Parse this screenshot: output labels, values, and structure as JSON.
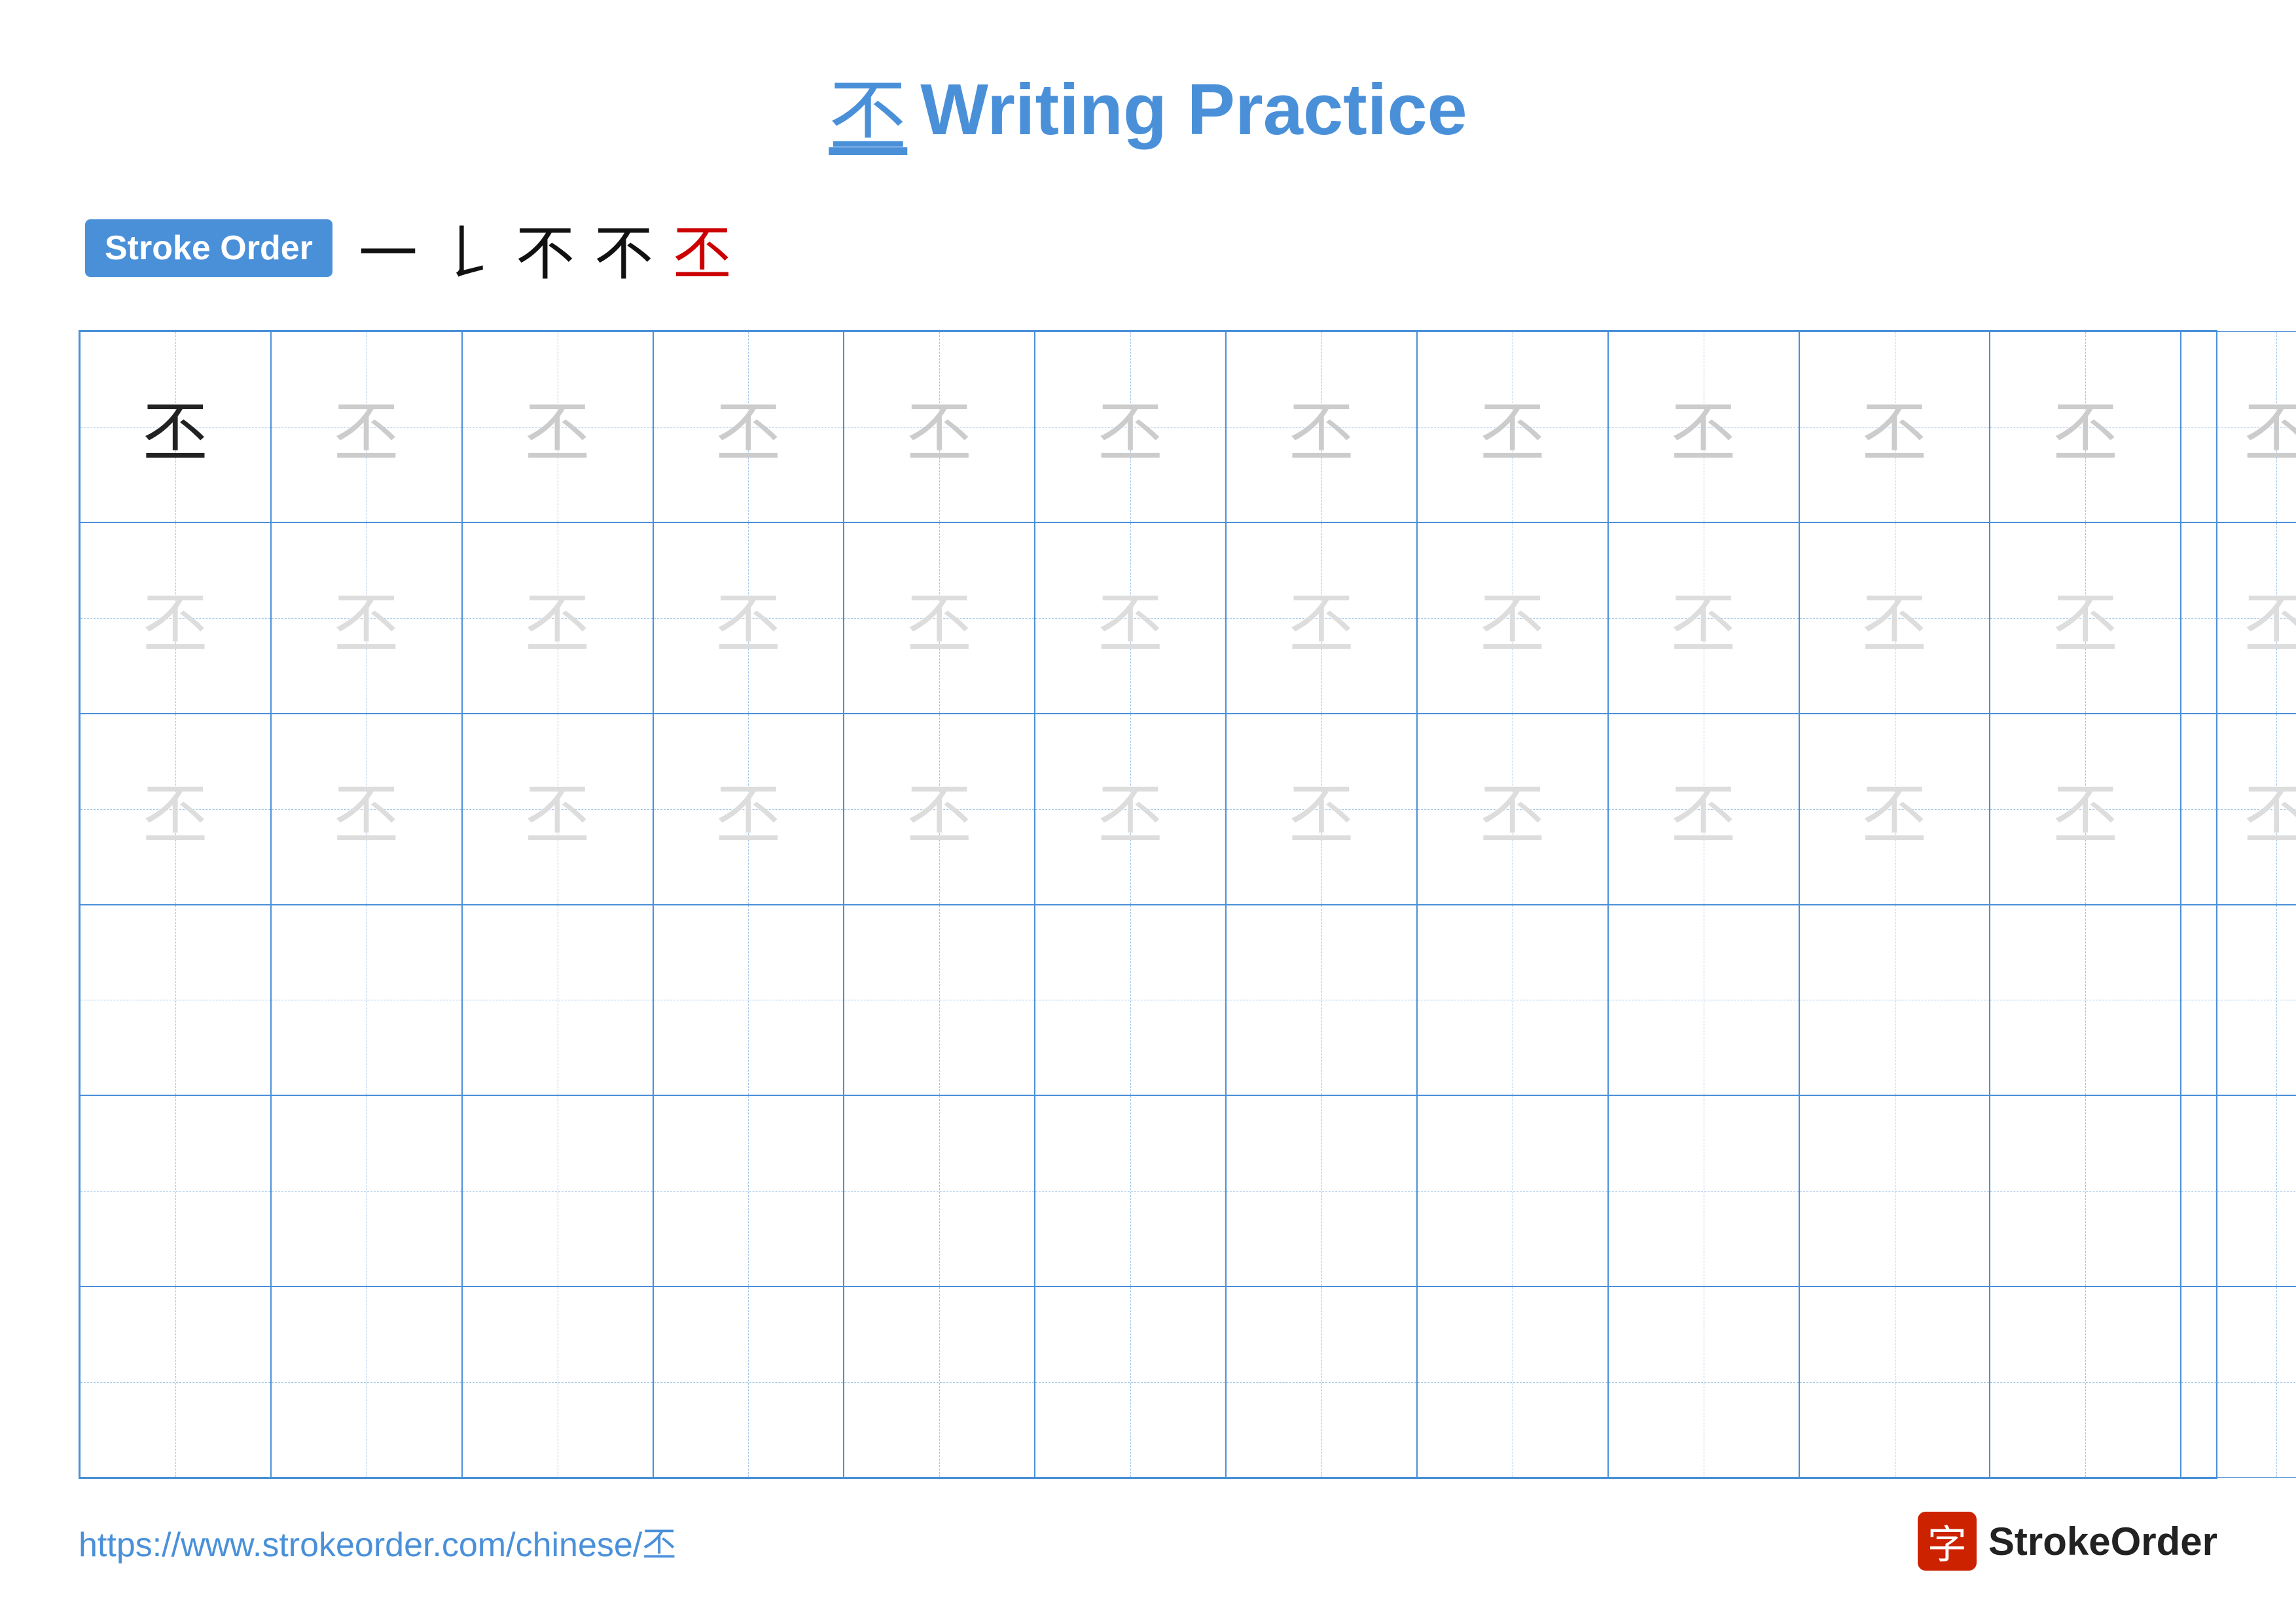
{
  "title": {
    "char": "丕",
    "text": "Writing Practice"
  },
  "stroke_order": {
    "badge_label": "Stroke Order",
    "strokes": [
      "一",
      "𠄌",
      "不",
      "不",
      "丕"
    ]
  },
  "grid": {
    "cols": 13,
    "rows": 6,
    "char": "丕",
    "filled_rows": 3
  },
  "footer": {
    "url": "https://www.strokeorder.com/chinese/丕",
    "logo_char": "字",
    "logo_text": "StrokeOrder"
  }
}
